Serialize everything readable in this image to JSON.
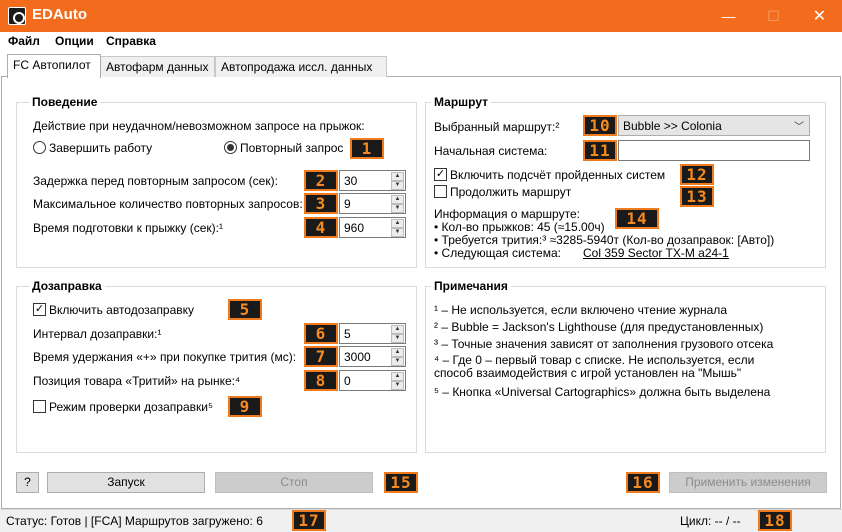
{
  "window": {
    "title": "EDAuto",
    "minimize": "—",
    "maximize": "☐",
    "close": "✕"
  },
  "menu": [
    "Файл",
    "Опции",
    "Справка"
  ],
  "tabs": [
    "FC Автопилот",
    "Автофарм данных",
    "Автопродажа иссл. данных"
  ],
  "behavior": {
    "title": "Поведение",
    "on_fail_label": "Действие при неудачном/невозможном запросе на прыжок:",
    "radio_finish": "Завершить работу",
    "radio_retry": "Повторный запрос",
    "retry_selected": true,
    "delay_label": "Задержка перед повторным запросом (сек):",
    "delay_value": "30",
    "max_retries_label": "Максимальное количество повторных запросов:",
    "max_retries_value": "9",
    "prep_time_label": "Время подготовки к прыжку (сек):¹",
    "prep_time_value": "960"
  },
  "route": {
    "title": "Маршрут",
    "selected_label": "Выбранный маршрут:²",
    "selected_value": "Bubble >> Colonia",
    "start_label": "Начальная система:",
    "start_value": "",
    "count_visited_label": "Включить подсчёт пройденных систем",
    "count_visited_checked": true,
    "continue_label": "Продолжить маршрут",
    "continue_checked": false,
    "info_label": "Информация о маршруте:",
    "jumps_line": "• Кол-во прыжков: 45 (≈15.00ч)",
    "tritium_line": "• Требуется трития:³ ≈3285-5940т (Кол-во дозаправок: [Авто])",
    "next_label": "• Следующая система:",
    "next_value": "Col 359 Sector TX-M a24-1"
  },
  "refuel": {
    "title": "Дозаправка",
    "auto_label": "Включить автодозаправку",
    "auto_checked": true,
    "interval_label": "Интервал дозаправки:¹",
    "interval_value": "5",
    "hold_label": "Время удержания «+» при покупке трития (мс):",
    "hold_value": "3000",
    "position_label": "Позиция товара «Тритий» на рынке:⁴",
    "position_value": "0",
    "check_mode_label": "Режим проверки дозаправки⁵",
    "check_mode_checked": false
  },
  "notes": {
    "title": "Примечания",
    "lines": [
      "¹ – Не используется, если включено чтение журнала",
      "² – Bubble = Jackson's Lighthouse (для предустановленных)",
      "³ – Точные значения зависят от заполнения грузового отсека",
      "⁴ – Где 0 – первый товар с списке. Не используется, если",
      "способ взаимодействия с игрой установлен на \"Мышь\"",
      "⁵ – Кнопка «Universal Cartographics» должна быть выделена"
    ]
  },
  "buttons": {
    "help": "?",
    "start": "Запуск",
    "stop": "Стоп",
    "apply": "Применить изменения"
  },
  "status": {
    "left": "Статус: Готов | [FCA] Маршрутов загружено: 6",
    "right": "Цикл: -- / --"
  },
  "badges": [
    "1",
    "2",
    "3",
    "4",
    "5",
    "6",
    "7",
    "8",
    "9",
    "10",
    "11",
    "12",
    "13",
    "14",
    "15",
    "16",
    "17",
    "18"
  ],
  "colors": {
    "titlebar": "#f36c1d",
    "badge_bg": "#1a1a1a",
    "badge_fg": "#f58a1f"
  }
}
